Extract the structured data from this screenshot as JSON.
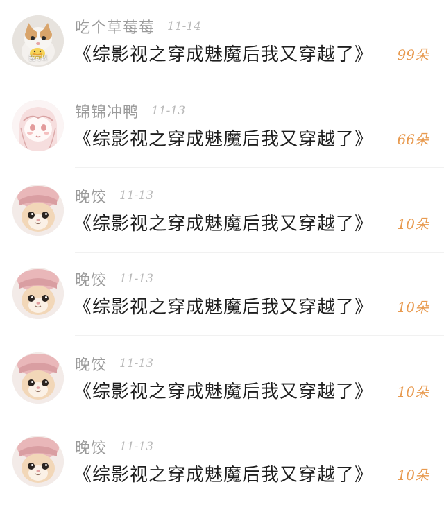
{
  "comments": [
    {
      "username": "吃个草莓莓",
      "date": "11-14",
      "title": "《综影视之穿成魅魔后我又穿越了》",
      "count": "99朵",
      "avatar_caption": "我可以",
      "avatar_type": "kitten-with-duck"
    },
    {
      "username": "锦锦冲鸭",
      "date": "11-13",
      "title": "《综影视之穿成魅魔后我又穿越了》",
      "count": "66朵",
      "avatar_type": "anime-girl-sketch"
    },
    {
      "username": "晚饺",
      "date": "11-13",
      "title": "《综影视之穿成魅魔后我又穿越了》",
      "count": "10朵",
      "avatar_type": "cat-in-pink-hat"
    },
    {
      "username": "晚饺",
      "date": "11-13",
      "title": "《综影视之穿成魅魔后我又穿越了》",
      "count": "10朵",
      "avatar_type": "cat-in-pink-hat"
    },
    {
      "username": "晚饺",
      "date": "11-13",
      "title": "《综影视之穿成魅魔后我又穿越了》",
      "count": "10朵",
      "avatar_type": "cat-in-pink-hat"
    },
    {
      "username": "晚饺",
      "date": "11-13",
      "title": "《综影视之穿成魅魔后我又穿越了》",
      "count": "10朵",
      "avatar_type": "cat-in-pink-hat"
    }
  ],
  "colors": {
    "username": "#9b9b9b",
    "date": "#b9b9b9",
    "title": "#1f1f1f",
    "count": "#e89a4f",
    "divider": "#f1f1f1"
  }
}
